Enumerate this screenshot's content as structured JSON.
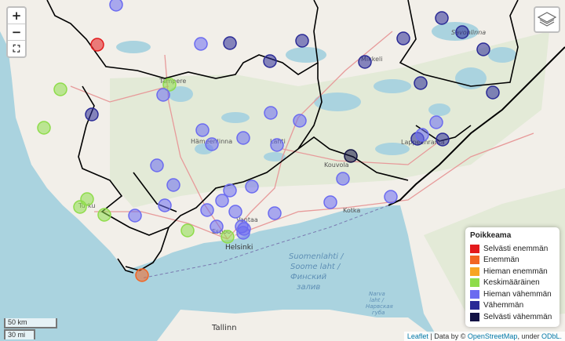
{
  "map": {
    "zoom_in": "+",
    "zoom_out": "−",
    "fullscreen_icon": "⛶",
    "layers_icon": "layers-icon"
  },
  "labels": {
    "tampere": "Tampere",
    "hameenlinna": "Hämeenlinna",
    "lahti": "Lahti",
    "mikkeli": "Mikkeli",
    "savonlinna": "Savonlinna",
    "kouvola": "Kouvola",
    "kotka": "Kotka",
    "lappeenranta": "Lappeenranta",
    "vantaa": "Vantaa",
    "espoo": "Espoo",
    "helsinki": "Helsinki",
    "turku": "Turku",
    "tallinn": "Tallinn",
    "gulf_fi": "Suomenlahti /",
    "gulf_sv": "Soome laht /",
    "gulf_ru1": "Финский",
    "gulf_ru2": "залив",
    "narva1": "Narva",
    "narva2": "laht /",
    "narva3": "Нарвская",
    "narva4": "губа"
  },
  "legend": {
    "title": "Poikkeama",
    "items": [
      {
        "label": "Selvästi enemmän",
        "color": "#e31a1c"
      },
      {
        "label": "Enemmän",
        "color": "#f26522"
      },
      {
        "label": "Hieman enemmän",
        "color": "#f7a521"
      },
      {
        "label": "Keskimääräinen",
        "color": "#8edc4a"
      },
      {
        "label": "Hieman vähemmän",
        "color": "#6b6bf0"
      },
      {
        "label": "Vähemmän",
        "color": "#2a2a96"
      },
      {
        "label": "Selvästi vähemmän",
        "color": "#121244"
      }
    ]
  },
  "scale": {
    "km": "50 km",
    "mi": "30 mi"
  },
  "attribution": {
    "leaflet": "Leaflet",
    "sep": " | Data by © ",
    "osm": "OpenStreetMap",
    "under": ", under ",
    "odbl": "ODbL."
  }
}
